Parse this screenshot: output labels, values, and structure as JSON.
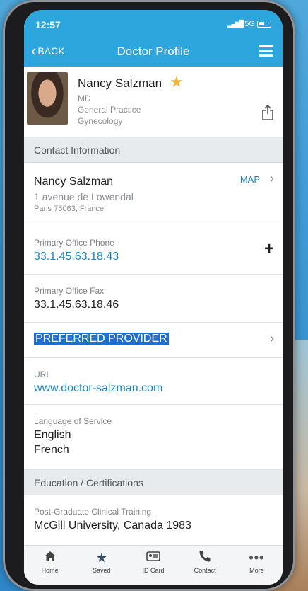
{
  "status": {
    "time": "12:57",
    "network": "5G"
  },
  "nav": {
    "back_label": "BACK",
    "title": "Doctor Profile"
  },
  "doctor": {
    "name": "Nancy Salzman",
    "degree": "MD",
    "specialties": [
      "General Practice",
      "Gynecology"
    ]
  },
  "sections": {
    "contact": "Contact Information",
    "education": "Education / Certifications"
  },
  "contact": {
    "name": "Nancy Salzman",
    "address_line1": "1 avenue de Lowendal",
    "address_line2": "Paris 75063, France",
    "map_label": "MAP",
    "phone_label": "Primary Office Phone",
    "phone": "33.1.45.63.18.43",
    "fax_label": "Primary Office Fax",
    "fax": "33.1.45.63.18.46",
    "preferred": "PREFERRED PROVIDER",
    "url_label": "URL",
    "url": "www.doctor-salzman.com",
    "language_label": "Language of Service",
    "languages": [
      "English",
      "French"
    ]
  },
  "education": {
    "training_label": "Post-Graduate Clinical Training",
    "training": "McGill University, Canada 1983"
  },
  "tabs": [
    {
      "label": "Home",
      "icon": "home-icon"
    },
    {
      "label": "Saved",
      "icon": "star-icon"
    },
    {
      "label": "ID Card",
      "icon": "id-card-icon"
    },
    {
      "label": "Contact",
      "icon": "phone-icon"
    },
    {
      "label": "More",
      "icon": "more-icon"
    }
  ],
  "colors": {
    "accent": "#2ca6dc",
    "link": "#1a86c6",
    "star": "#f0b43a",
    "selection": "#1f6fd1"
  }
}
